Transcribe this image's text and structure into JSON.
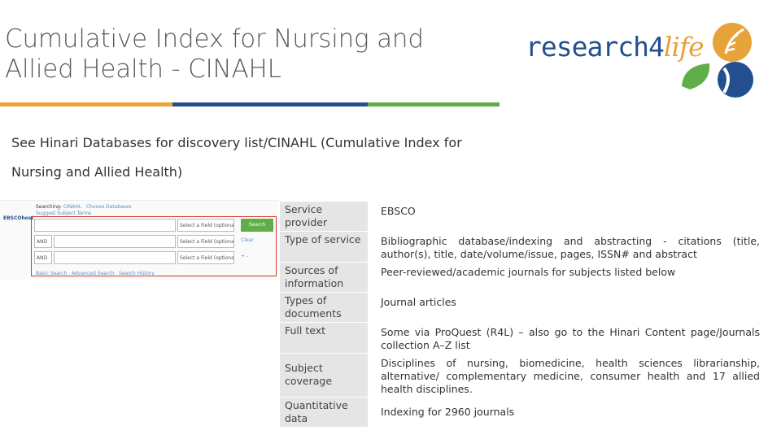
{
  "title": {
    "line1": "Cumulative Index for Nursing and",
    "line2": "Allied Health - CINAHL"
  },
  "logo": {
    "text_a": "research",
    "text_b": "4",
    "text_c": "life",
    "icon": "research4life-leaf-icon"
  },
  "description": {
    "line1": "See Hinari Databases for discovery list/CINAHL (Cumulative Index for",
    "line2": "Nursing and Allied Health)"
  },
  "ebsco": {
    "logo": "EBSCOhost",
    "searching_label": "Searching:",
    "database": "CINAHL",
    "choose_databases": "Choose Databases",
    "suggest": "Suggest Subject Terms",
    "rows": [
      {
        "bool": "",
        "field": "Select a Field (optional)",
        "control": "Search"
      },
      {
        "bool": "AND",
        "field": "Select a Field (optional)",
        "control": "Clear"
      },
      {
        "bool": "AND",
        "field": "Select a Field (optional)",
        "control": "+ -"
      }
    ],
    "links": [
      "Basic Search",
      "Advanced Search",
      "Search History"
    ]
  },
  "table": [
    {
      "label": "Service provider",
      "value": "EBSCO"
    },
    {
      "label": "Type of service",
      "value": "Bibliographic database/indexing and abstracting - citations (title, author(s), title, date/volume/issue, pages, ISSN# and abstract"
    },
    {
      "label": "Sources of information",
      "value": "Peer-reviewed/academic journals for subjects listed below"
    },
    {
      "label": "Types of documents",
      "value": "Journal articles"
    },
    {
      "label": "Full text",
      "value": "Some via ProQuest (R4L) – also go to the Hinari Content page/Journals collection A–Z list"
    },
    {
      "label": "Subject coverage",
      "value": "Disciplines of nursing, biomedicine, health sciences librarianship, alternative/ complementary medicine, consumer health and 17 allied health disciplines."
    },
    {
      "label": "Quantitative data",
      "value": "Indexing for 2960 journals"
    }
  ],
  "colors": {
    "orange": "#e8a23a",
    "blue": "#244f8e",
    "green": "#5fae47",
    "red_box": "#d9342b"
  }
}
